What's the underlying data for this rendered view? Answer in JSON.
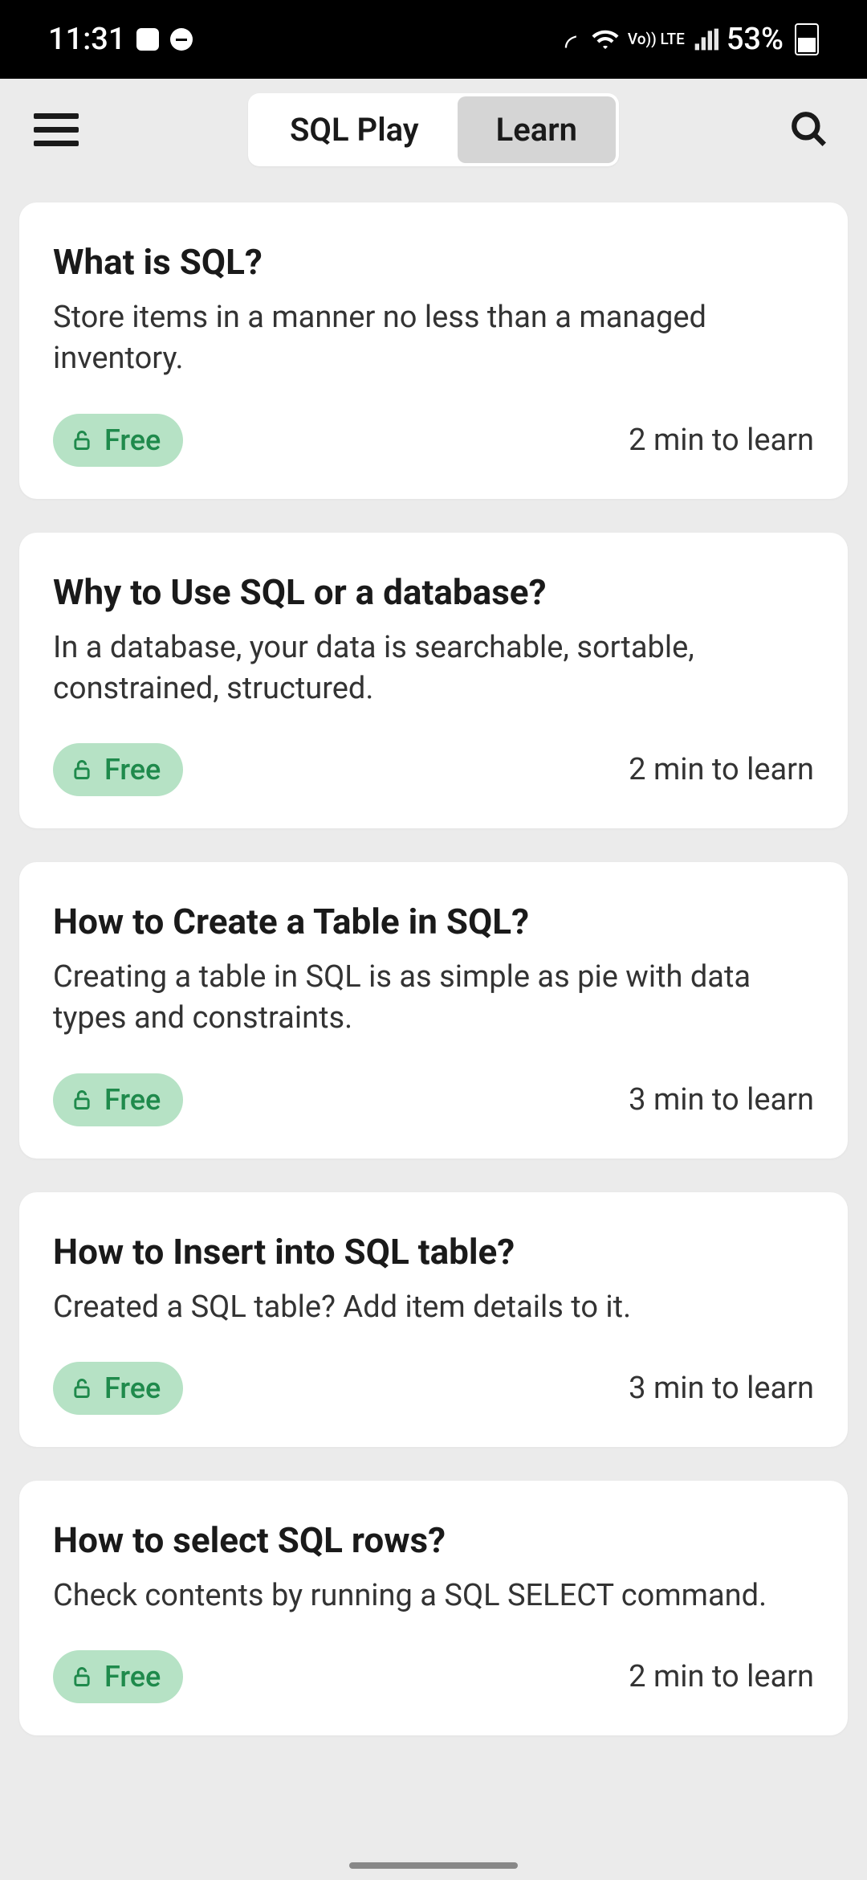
{
  "status": {
    "time": "11:31",
    "battery_pct": "53%",
    "network_label": "Vo)) LTE"
  },
  "header": {
    "tabs": [
      {
        "label": "SQL Play",
        "active": false
      },
      {
        "label": "Learn",
        "active": true
      }
    ]
  },
  "lessons": [
    {
      "title": "What is SQL?",
      "desc": "Store items in a manner no less than a managed inventory.",
      "badge": "Free",
      "duration": "2 min to learn"
    },
    {
      "title": "Why to Use SQL or a database?",
      "desc": "In a database, your data is searchable, sortable, constrained, structured.",
      "badge": "Free",
      "duration": "2 min to learn"
    },
    {
      "title": "How to Create a Table in SQL?",
      "desc": "Creating a table in SQL is as simple as pie with data types and constraints.",
      "badge": "Free",
      "duration": "3 min to learn"
    },
    {
      "title": "How to Insert into SQL table?",
      "desc": "Created a SQL table? Add item details to it.",
      "badge": "Free",
      "duration": "3 min to learn"
    },
    {
      "title": "How to select SQL rows?",
      "desc": "Check contents by running a SQL SELECT command.",
      "badge": "Free",
      "duration": "2 min to learn"
    }
  ]
}
